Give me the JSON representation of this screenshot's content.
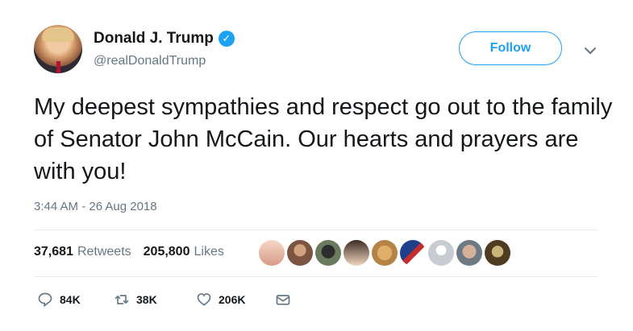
{
  "author": {
    "name": "Donald J. Trump",
    "handle": "@realDonaldTrump",
    "verified_icon": "checkmark-icon",
    "follow_label": "Follow"
  },
  "tweet": {
    "text": "My deepest sympathies and respect go out to the family of Senator John McCain. Our hearts and prayers are with you!",
    "timestamp": "3:44 AM - 26 Aug 2018"
  },
  "stats": {
    "retweets_count": "37,681",
    "retweets_label": "Retweets",
    "likes_count": "205,800",
    "likes_label": "Likes"
  },
  "likers": [
    "liker-avatar-1",
    "liker-avatar-2",
    "liker-avatar-3",
    "liker-avatar-4",
    "liker-avatar-5",
    "liker-avatar-6",
    "liker-avatar-7",
    "liker-avatar-8",
    "liker-avatar-9"
  ],
  "actions": {
    "reply_count": "84K",
    "retweet_count": "38K",
    "like_count": "206K"
  },
  "colors": {
    "accent": "#1da1f2",
    "muted": "#657786",
    "text": "#14171a",
    "border": "#e6ecf0"
  }
}
